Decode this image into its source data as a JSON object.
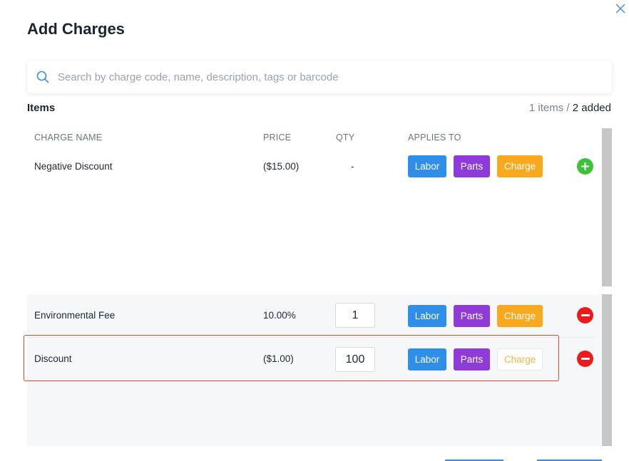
{
  "dialog": {
    "title": "Add Charges",
    "close_icon": "close-icon"
  },
  "search": {
    "placeholder": "Search by charge code, name, description, tags or barcode",
    "value": "",
    "icon": "search-icon"
  },
  "items_header": {
    "label": "Items",
    "count_text": "1 items /",
    "added_text": "2 added"
  },
  "columns": {
    "name": "CHARGE NAME",
    "price": "PRICE",
    "qty": "QTY",
    "applies_to": "APPLIES TO"
  },
  "available_items": [
    {
      "name": "Negative Discount",
      "price": "($15.00)",
      "qty": "-",
      "labor": "Labor",
      "parts": "Parts",
      "charge": "Charge",
      "charge_active": true,
      "action_icon": "plus-circle-icon"
    }
  ],
  "added_items": [
    {
      "name": "Environmental Fee",
      "price": "10.00%",
      "qty": "1",
      "labor": "Labor",
      "parts": "Parts",
      "charge": "Charge",
      "charge_active": true,
      "action_icon": "minus-circle-icon"
    },
    {
      "name": "Discount",
      "price": "($1.00)",
      "qty": "100",
      "labor": "Labor",
      "parts": "Parts",
      "charge": "Charge",
      "charge_active": false,
      "action_icon": "minus-circle-icon"
    }
  ],
  "colors": {
    "labor": "#2e8ee8",
    "parts": "#8e3bd8",
    "charge": "#f8a91d",
    "add": "#3ec13a",
    "remove": "#ec1a1a",
    "highlight": "#e04a2a"
  }
}
